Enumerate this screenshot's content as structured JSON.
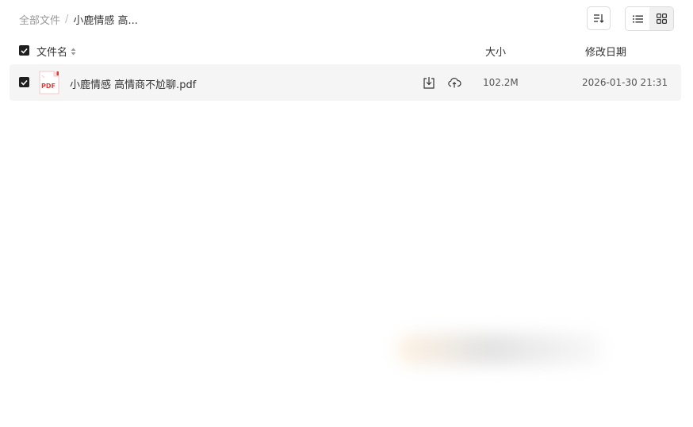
{
  "breadcrumb": {
    "root": "全部文件",
    "separator": "/",
    "current": "小鹿情感 高..."
  },
  "toolbar": {
    "sort_icon": "sort-icon",
    "list_view_icon": "list-view-icon",
    "grid_view_icon": "grid-view-icon",
    "active_view": "grid"
  },
  "table": {
    "columns": {
      "name": "文件名",
      "size": "大小",
      "date": "修改日期"
    },
    "rows": [
      {
        "name": "小鹿情感 高情商不尬聊.pdf",
        "type_label": "PDF",
        "size": "102.2M",
        "modified": "2026-01-30 21:31",
        "checked": true
      }
    ]
  },
  "colors": {
    "checkbox": "#1f1f1f",
    "row_background": "#f5f5f5",
    "pdf_red": "#e53935"
  }
}
